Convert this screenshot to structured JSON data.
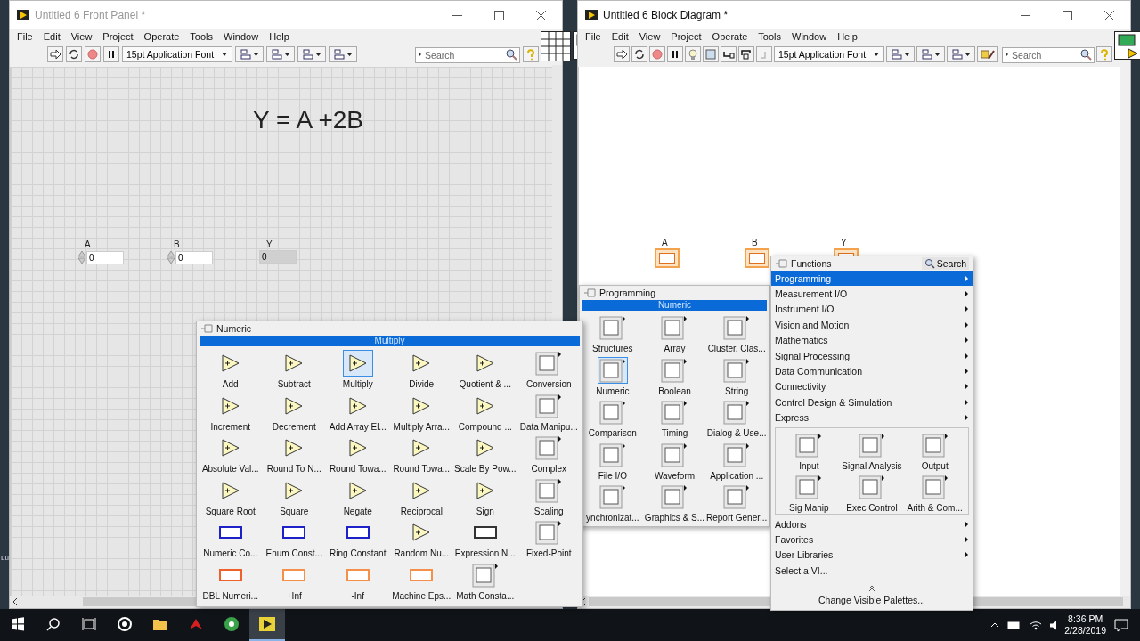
{
  "desktop_text": "Lu",
  "front_panel": {
    "title": "Untitled 6 Front Panel *",
    "active": false,
    "menu": [
      "File",
      "Edit",
      "View",
      "Project",
      "Operate",
      "Tools",
      "Window",
      "Help"
    ],
    "font": "15pt Application Font",
    "search": {
      "placeholder": "Search"
    },
    "label": "Y = A +2B",
    "controls": [
      {
        "label": "A",
        "value": "0",
        "kind": "control"
      },
      {
        "label": "B",
        "value": "0",
        "kind": "control"
      },
      {
        "label": "Y",
        "value": "0",
        "kind": "indicator"
      }
    ]
  },
  "block_diagram": {
    "title": "Untitled 6 Block Diagram *",
    "active": true,
    "menu": [
      "File",
      "Edit",
      "View",
      "Project",
      "Operate",
      "Tools",
      "Window",
      "Help"
    ],
    "font": "15pt Application Font",
    "search": {
      "placeholder": "Search"
    },
    "terminals": [
      {
        "label": "A"
      },
      {
        "label": "B"
      },
      {
        "label": "Y"
      }
    ]
  },
  "numeric_palette": {
    "title": "Numeric",
    "highlight": "Multiply",
    "items": [
      {
        "label": "Add",
        "kind": "node",
        "selected": false
      },
      {
        "label": "Subtract",
        "kind": "node",
        "selected": false
      },
      {
        "label": "Multiply",
        "kind": "node",
        "selected": true
      },
      {
        "label": "Divide",
        "kind": "node",
        "selected": false
      },
      {
        "label": "Quotient & ...",
        "kind": "node",
        "selected": false
      },
      {
        "label": "Conversion",
        "kind": "subpalette",
        "selected": false
      },
      {
        "label": "Increment",
        "kind": "node",
        "selected": false
      },
      {
        "label": "Decrement",
        "kind": "node",
        "selected": false
      },
      {
        "label": "Add Array El...",
        "kind": "node",
        "selected": false
      },
      {
        "label": "Multiply Arra...",
        "kind": "node",
        "selected": false
      },
      {
        "label": "Compound ...",
        "kind": "node",
        "selected": false
      },
      {
        "label": "Data Manipu...",
        "kind": "subpalette",
        "selected": false
      },
      {
        "label": "Absolute Val...",
        "kind": "node",
        "selected": false
      },
      {
        "label": "Round To N...",
        "kind": "node",
        "selected": false
      },
      {
        "label": "Round Towa...",
        "kind": "node",
        "selected": false
      },
      {
        "label": "Round Towa...",
        "kind": "node",
        "selected": false
      },
      {
        "label": "Scale By Pow...",
        "kind": "node",
        "selected": false
      },
      {
        "label": "Complex",
        "kind": "subpalette",
        "selected": false
      },
      {
        "label": "Square Root",
        "kind": "node",
        "selected": false
      },
      {
        "label": "Square",
        "kind": "node",
        "selected": false
      },
      {
        "label": "Negate",
        "kind": "node",
        "selected": false
      },
      {
        "label": "Reciprocal",
        "kind": "node",
        "selected": false
      },
      {
        "label": "Sign",
        "kind": "node",
        "selected": false
      },
      {
        "label": "Scaling",
        "kind": "subpalette",
        "selected": false
      },
      {
        "label": "Numeric Co...",
        "kind": "constant",
        "color": "#1c22c8",
        "selected": false
      },
      {
        "label": "Enum Const...",
        "kind": "constant",
        "color": "#1c22c8",
        "selected": false
      },
      {
        "label": "Ring Constant",
        "kind": "constant",
        "color": "#1c22c8",
        "selected": false
      },
      {
        "label": "Random Nu...",
        "kind": "node",
        "selected": false
      },
      {
        "label": "Expression N...",
        "kind": "constant",
        "color": "#333333",
        "selected": false
      },
      {
        "label": "Fixed-Point",
        "kind": "subpalette",
        "selected": false
      },
      {
        "label": "DBL Numeri...",
        "kind": "constant",
        "color": "#f0602a",
        "selected": false
      },
      {
        "label": "+Inf",
        "kind": "constant",
        "color": "#f5904a",
        "selected": false
      },
      {
        "label": "-Inf",
        "kind": "constant",
        "color": "#f5904a",
        "selected": false
      },
      {
        "label": "Machine Eps...",
        "kind": "constant",
        "color": "#f5904a",
        "selected": false
      },
      {
        "label": "Math Consta...",
        "kind": "subpalette",
        "selected": false
      }
    ]
  },
  "programming_palette": {
    "title": "Programming",
    "highlight": "Numeric",
    "items": [
      {
        "label": "Structures",
        "kind": "subpalette",
        "selected": false
      },
      {
        "label": "Array",
        "kind": "subpalette",
        "selected": false
      },
      {
        "label": "Cluster, Clas...",
        "kind": "subpalette",
        "selected": false
      },
      {
        "label": "Numeric",
        "kind": "subpalette",
        "selected": true
      },
      {
        "label": "Boolean",
        "kind": "subpalette",
        "selected": false
      },
      {
        "label": "String",
        "kind": "subpalette",
        "selected": false
      },
      {
        "label": "Comparison",
        "kind": "subpalette",
        "selected": false
      },
      {
        "label": "Timing",
        "kind": "subpalette",
        "selected": false
      },
      {
        "label": "Dialog & Use...",
        "kind": "subpalette",
        "selected": false
      },
      {
        "label": "File I/O",
        "kind": "subpalette",
        "selected": false
      },
      {
        "label": "Waveform",
        "kind": "subpalette",
        "selected": false
      },
      {
        "label": "Application ...",
        "kind": "subpalette",
        "selected": false
      },
      {
        "label": "ynchronizat...",
        "kind": "subpalette",
        "selected": false
      },
      {
        "label": "Graphics & S...",
        "kind": "subpalette",
        "selected": false
      },
      {
        "label": "Report Gener...",
        "kind": "subpalette",
        "selected": false
      }
    ]
  },
  "functions_palette": {
    "title": "Functions",
    "search": "Search",
    "categories": [
      {
        "label": "Programming",
        "selected": true,
        "submenu": true
      },
      {
        "label": "Measurement I/O",
        "selected": false,
        "submenu": true
      },
      {
        "label": "Instrument I/O",
        "selected": false,
        "submenu": true
      },
      {
        "label": "Vision and Motion",
        "selected": false,
        "submenu": true
      },
      {
        "label": "Mathematics",
        "selected": false,
        "submenu": true
      },
      {
        "label": "Signal Processing",
        "selected": false,
        "submenu": true
      },
      {
        "label": "Data Communication",
        "selected": false,
        "submenu": true
      },
      {
        "label": "Connectivity",
        "selected": false,
        "submenu": true
      },
      {
        "label": "Control Design & Simulation",
        "selected": false,
        "submenu": true
      },
      {
        "label": "Express",
        "selected": false,
        "submenu": true
      }
    ],
    "express": [
      {
        "label": "Input",
        "kind": "subpalette",
        "selected": false
      },
      {
        "label": "Signal Analysis",
        "kind": "subpalette",
        "selected": false
      },
      {
        "label": "Output",
        "kind": "subpalette",
        "selected": false
      },
      {
        "label": "Sig Manip",
        "kind": "subpalette",
        "selected": false
      },
      {
        "label": "Exec Control",
        "kind": "subpalette",
        "selected": false
      },
      {
        "label": "Arith & Com...",
        "kind": "subpalette",
        "selected": false
      }
    ],
    "more": [
      {
        "label": "Addons",
        "selected": false,
        "submenu": true
      },
      {
        "label": "Favorites",
        "selected": false,
        "submenu": true
      },
      {
        "label": "User Libraries",
        "selected": false,
        "submenu": true
      },
      {
        "label": "Select a VI...",
        "selected": false,
        "submenu": false
      }
    ],
    "footer": "Change Visible Palettes..."
  },
  "taskbar": {
    "apps": [
      {
        "kind": "start",
        "selected": false
      },
      {
        "kind": "search",
        "selected": false
      },
      {
        "kind": "taskview",
        "selected": false
      },
      {
        "kind": "ring",
        "selected": false
      },
      {
        "kind": "folder",
        "selected": false
      },
      {
        "kind": "claw",
        "selected": false
      },
      {
        "kind": "green",
        "selected": false
      },
      {
        "kind": "labview",
        "selected": true
      }
    ],
    "time": "8:36 PM",
    "date": "2/28/2019"
  }
}
